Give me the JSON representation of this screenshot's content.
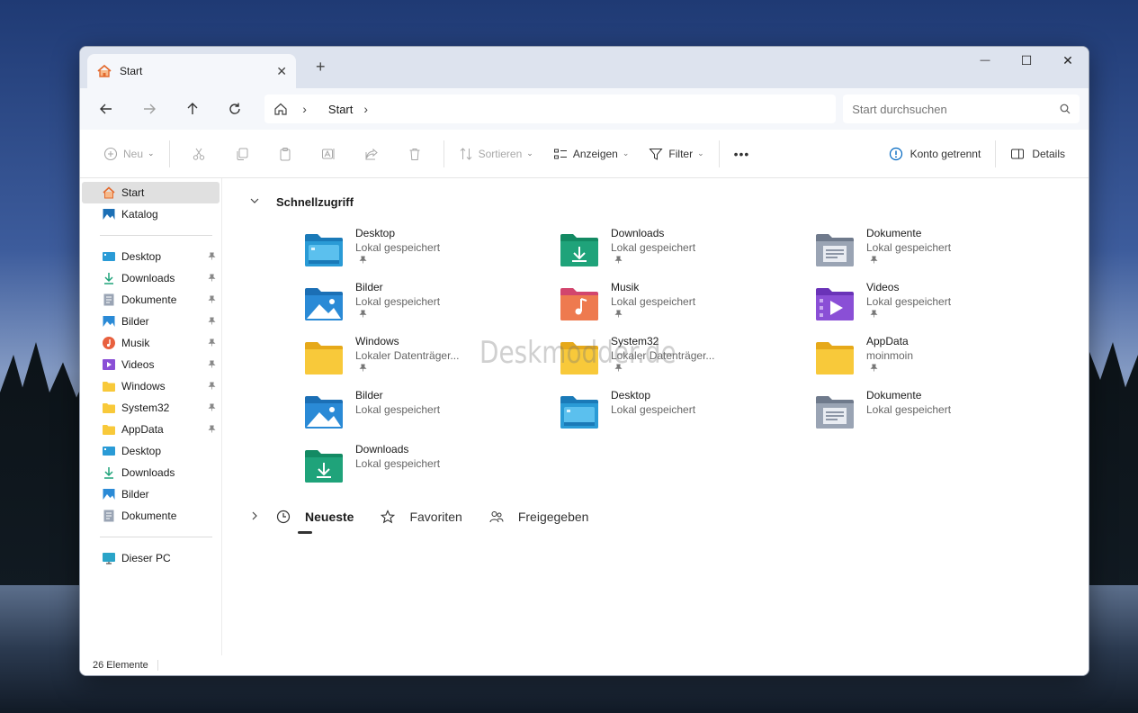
{
  "tab": {
    "title": "Start",
    "close": "✕",
    "new_tab": "+"
  },
  "window_controls": {
    "minimize": "—",
    "maximize": "☐",
    "close": "✕"
  },
  "nav": {
    "breadcrumb": [
      "Start"
    ],
    "search_placeholder": "Start durchsuchen"
  },
  "toolbar": {
    "new_label": "Neu",
    "sort_label": "Sortieren",
    "view_label": "Anzeigen",
    "filter_label": "Filter",
    "more_label": "•••",
    "account_label": "Konto getrennt",
    "details_label": "Details"
  },
  "sidebar": {
    "top": [
      {
        "label": "Start",
        "icon": "home-icon"
      },
      {
        "label": "Katalog",
        "icon": "gallery-icon"
      }
    ],
    "pinned": [
      {
        "label": "Desktop",
        "icon": "desktop-folder-icon",
        "pinned": true
      },
      {
        "label": "Downloads",
        "icon": "download-icon",
        "pinned": true
      },
      {
        "label": "Dokumente",
        "icon": "documents-icon",
        "pinned": true
      },
      {
        "label": "Bilder",
        "icon": "pictures-icon",
        "pinned": true
      },
      {
        "label": "Musik",
        "icon": "music-icon",
        "pinned": true
      },
      {
        "label": "Videos",
        "icon": "videos-icon",
        "pinned": true
      },
      {
        "label": "Windows",
        "icon": "folder-icon",
        "pinned": true
      },
      {
        "label": "System32",
        "icon": "folder-icon",
        "pinned": true
      },
      {
        "label": "AppData",
        "icon": "folder-icon",
        "pinned": true
      },
      {
        "label": "Desktop",
        "icon": "desktop-folder-icon",
        "pinned": false
      },
      {
        "label": "Downloads",
        "icon": "download-icon",
        "pinned": false
      },
      {
        "label": "Bilder",
        "icon": "pictures-icon",
        "pinned": false
      },
      {
        "label": "Dokumente",
        "icon": "documents-icon",
        "pinned": false
      }
    ],
    "bottom": [
      {
        "label": "Dieser PC",
        "icon": "pc-icon"
      }
    ]
  },
  "quick_access": {
    "title": "Schnellzugriff",
    "items": [
      {
        "name": "Desktop",
        "sub": "Lokal gespeichert",
        "pinned": true,
        "type": "desktop"
      },
      {
        "name": "Downloads",
        "sub": "Lokal gespeichert",
        "pinned": true,
        "type": "downloads"
      },
      {
        "name": "Dokumente",
        "sub": "Lokal gespeichert",
        "pinned": true,
        "type": "documents"
      },
      {
        "name": "Bilder",
        "sub": "Lokal gespeichert",
        "pinned": true,
        "type": "pictures"
      },
      {
        "name": "Musik",
        "sub": "Lokal gespeichert",
        "pinned": true,
        "type": "music"
      },
      {
        "name": "Videos",
        "sub": "Lokal gespeichert",
        "pinned": true,
        "type": "videos"
      },
      {
        "name": "Windows",
        "sub": "Lokaler Datenträger...",
        "pinned": true,
        "type": "plain"
      },
      {
        "name": "System32",
        "sub": "Lokaler Datenträger...",
        "pinned": true,
        "type": "plain"
      },
      {
        "name": "AppData",
        "sub": "moinmoin",
        "pinned": true,
        "type": "plain"
      },
      {
        "name": "Bilder",
        "sub": "Lokal gespeichert",
        "pinned": false,
        "type": "pictures"
      },
      {
        "name": "Desktop",
        "sub": "Lokal gespeichert",
        "pinned": false,
        "type": "desktop"
      },
      {
        "name": "Dokumente",
        "sub": "Lokal gespeichert",
        "pinned": false,
        "type": "documents"
      },
      {
        "name": "Downloads",
        "sub": "Lokal gespeichert",
        "pinned": false,
        "type": "downloads"
      }
    ]
  },
  "bottom_tabs": [
    {
      "label": "Neueste",
      "icon": "clock-icon",
      "selected": true
    },
    {
      "label": "Favoriten",
      "icon": "star-icon",
      "selected": false
    },
    {
      "label": "Freigegeben",
      "icon": "people-icon",
      "selected": false
    }
  ],
  "watermark": "Deskmodder.de",
  "status": {
    "count": "26 Elemente"
  },
  "colors": {
    "accent": "#0067c0",
    "folder_yellow": "#f8c93a",
    "folder_blue": "#2a9bd6",
    "folder_green": "#1fa37a"
  }
}
